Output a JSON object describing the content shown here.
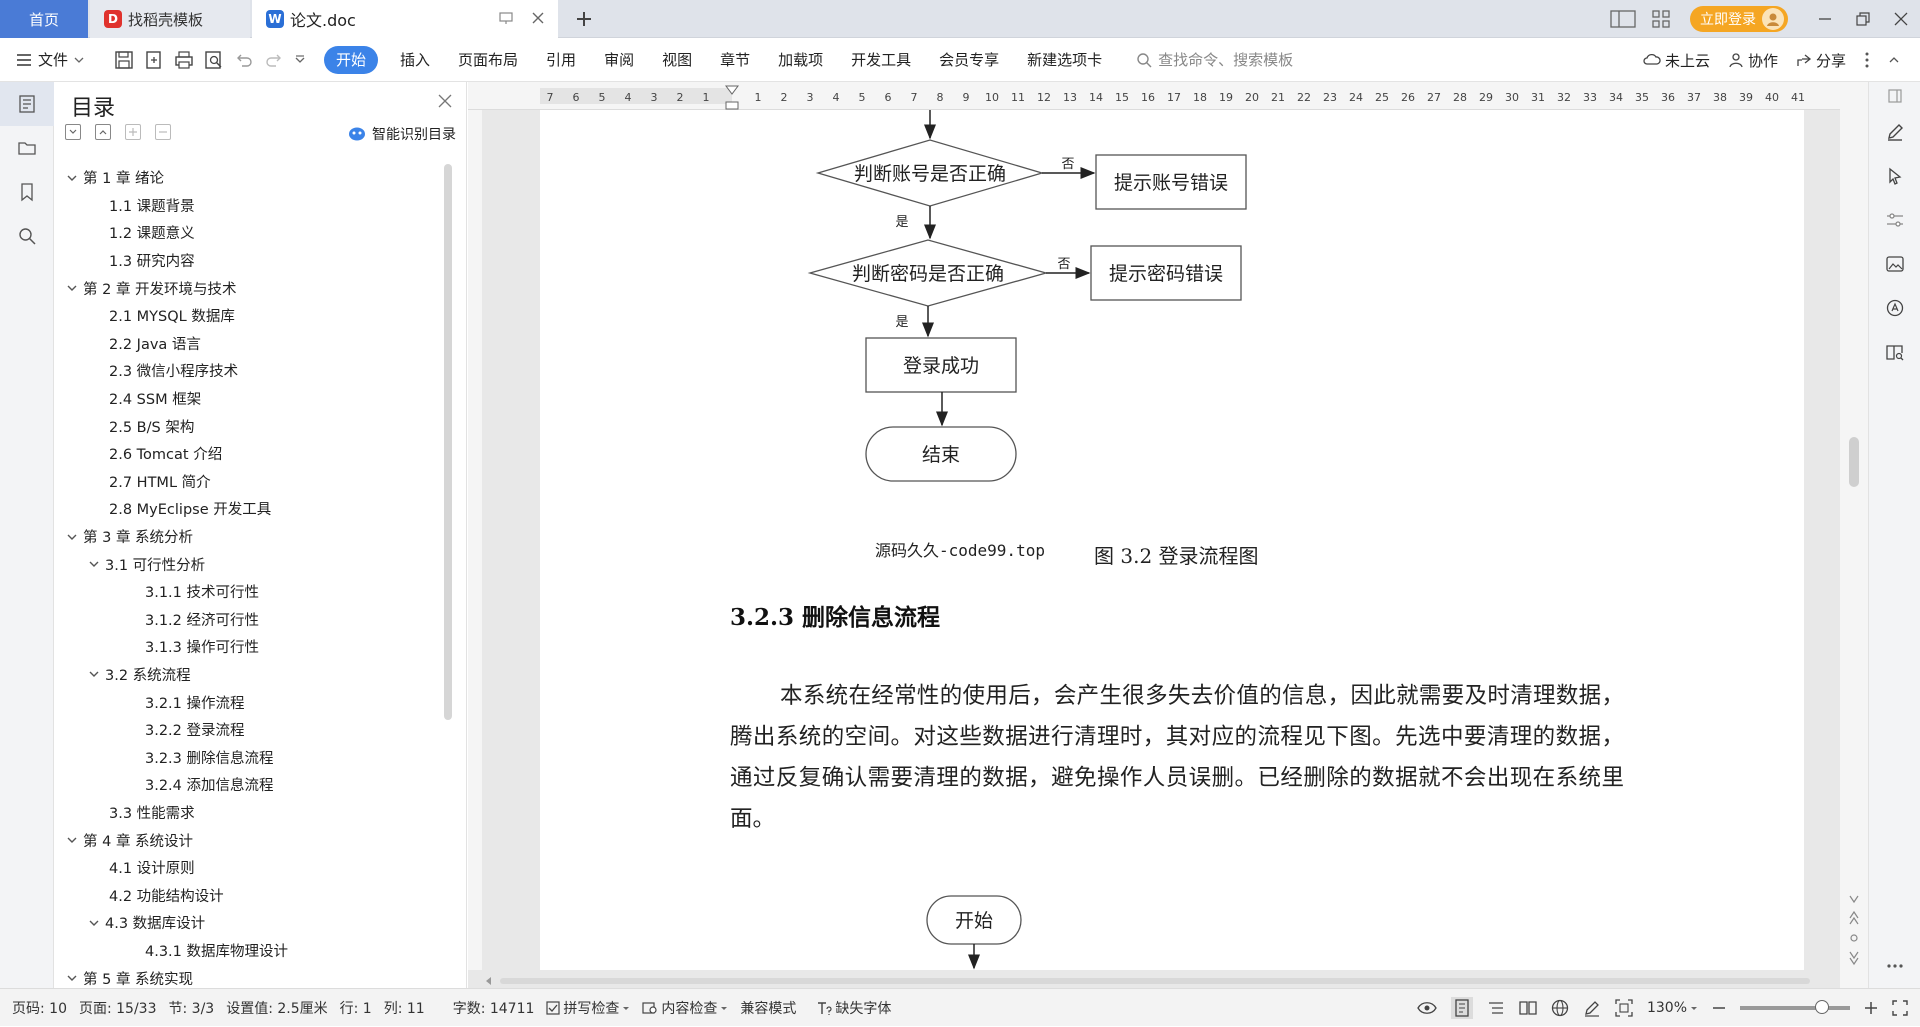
{
  "titlebar": {
    "tab_home": "首页",
    "tab_template": "找稻壳模板",
    "tab_doc": "论文.doc",
    "login": "立即登录"
  },
  "menubar": {
    "file": "文件",
    "items": [
      "开始",
      "插入",
      "页面布局",
      "引用",
      "审阅",
      "视图",
      "章节",
      "加载项",
      "开发工具",
      "会员专享",
      "新建选项卡"
    ],
    "search_placeholder": "查找命令、搜索模板",
    "cloud": "未上云",
    "collab": "协作",
    "share": "分享"
  },
  "toc": {
    "title": "目录",
    "smart": "智能识别目录",
    "items": [
      {
        "label": "第 1 章  绪论",
        "level": 1,
        "expanded": true
      },
      {
        "label": "1.1  课题背景",
        "level": 2
      },
      {
        "label": "1.2  课题意义",
        "level": 2
      },
      {
        "label": "1.3  研究内容",
        "level": 2
      },
      {
        "label": "第 2 章  开发环境与技术",
        "level": 1,
        "expanded": true
      },
      {
        "label": "2.1  MYSQL 数据库",
        "level": 2
      },
      {
        "label": "2.2  Java 语言",
        "level": 2
      },
      {
        "label": "2.3  微信小程序技术",
        "level": 2
      },
      {
        "label": "2.4  SSM 框架",
        "level": 2
      },
      {
        "label": "2.5  B/S 架构",
        "level": 2
      },
      {
        "label": "2.6  Tomcat 介绍",
        "level": 2
      },
      {
        "label": "2.7  HTML 简介",
        "level": 2
      },
      {
        "label": "2.8  MyEclipse 开发工具",
        "level": 2
      },
      {
        "label": "第 3 章  系统分析",
        "level": 1,
        "expanded": true
      },
      {
        "label": "3.1  可行性分析",
        "level": 2,
        "expanded": true
      },
      {
        "label": "3.1.1  技术可行性",
        "level": 3
      },
      {
        "label": "3.1.2  经济可行性",
        "level": 3
      },
      {
        "label": "3.1.3  操作可行性",
        "level": 3
      },
      {
        "label": "3.2  系统流程",
        "level": 2,
        "expanded": true
      },
      {
        "label": "3.2.1  操作流程",
        "level": 3
      },
      {
        "label": "3.2.2  登录流程",
        "level": 3
      },
      {
        "label": "3.2.3  删除信息流程",
        "level": 3
      },
      {
        "label": "3.2.4  添加信息流程",
        "level": 3
      },
      {
        "label": "3.3  性能需求",
        "level": 2
      },
      {
        "label": "第 4 章  系统设计",
        "level": 1,
        "expanded": true
      },
      {
        "label": "4.1  设计原则",
        "level": 2
      },
      {
        "label": "4.2  功能结构设计",
        "level": 2
      },
      {
        "label": "4.3  数据库设计",
        "level": 2,
        "expanded": true
      },
      {
        "label": "4.3.1  数据库物理设计",
        "level": 3
      },
      {
        "label": "第 5 章  系统实现",
        "level": 1,
        "expanded": true
      }
    ]
  },
  "ruler": {
    "left_ticks": [
      "7",
      "6",
      "5",
      "4",
      "3",
      "2",
      "1"
    ],
    "right_ticks": [
      "1",
      "2",
      "3",
      "4",
      "5",
      "6",
      "7",
      "8",
      "9",
      "10",
      "11",
      "12",
      "13",
      "14",
      "15",
      "16",
      "17",
      "18",
      "19",
      "20",
      "21",
      "22",
      "23",
      "24",
      "25",
      "26",
      "27",
      "28",
      "29",
      "30",
      "31",
      "32",
      "33",
      "34",
      "35",
      "36",
      "37",
      "38",
      "39",
      "40",
      "41"
    ]
  },
  "document": {
    "flowchart": {
      "check_account": "判断账号是否正确",
      "account_error": "提示账号错误",
      "check_password": "判断密码是否正确",
      "password_error": "提示密码错误",
      "login_success": "登录成功",
      "end": "结束",
      "yes": "是",
      "no": "否",
      "start": "开始"
    },
    "source": "源码久久-code99.top",
    "caption": "图 3.2  登录流程图",
    "heading": "3.2.3  删除信息流程",
    "paragraph": "本系统在经常性的使用后，会产生很多失去价值的信息，因此就需要及时清理数据，腾出系统的空间。对这些数据进行清理时，其对应的流程见下图。先选中要清理的数据，通过反复确认需要清理的数据，避免操作人员误删。已经删除的数据就不会出现在系统里面。"
  },
  "statusbar": {
    "page_no": "页码: 10",
    "pages": "页面: 15/33",
    "section": "节: 3/3",
    "setting": "设置值: 2.5厘米",
    "row": "行: 1",
    "col": "列: 11",
    "words": "字数: 14711",
    "spell": "拼写检查",
    "content_check": "内容检查",
    "compat": "兼容模式",
    "missing_font": "缺失字体",
    "zoom": "130%",
    "zoom_fraction": 0.68
  },
  "colors": {
    "accent": "#3b83e8",
    "login": "#f5a623",
    "home_tab": "#4a7bd6"
  }
}
